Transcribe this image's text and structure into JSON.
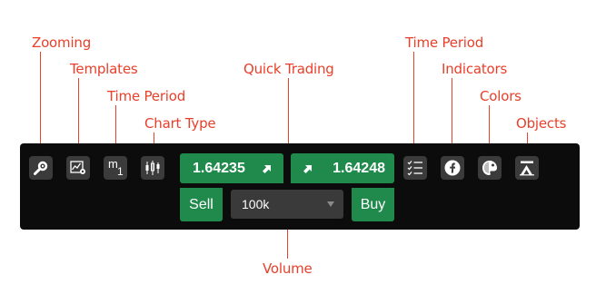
{
  "callouts": {
    "zooming": "Zooming",
    "templates": "Templates",
    "time_period_left": "Time Period",
    "chart_type": "Chart Type",
    "quick_trading": "Quick Trading",
    "time_period_right": "Time Period",
    "indicators": "Indicators",
    "colors": "Colors",
    "objects": "Objects",
    "volume": "Volume"
  },
  "toolbar": {
    "period_main": "m",
    "period_sub": "1",
    "sell_price": "1.64235",
    "buy_price": "1.64248",
    "sell_label": "Sell",
    "buy_label": "Buy",
    "volume_value": "100k"
  },
  "colors": {
    "callout": "#e8402a",
    "toolbar_bg": "#0c0c0c",
    "button_bg": "#3b3b3b",
    "trade_green": "#1f8a4c"
  },
  "icons": [
    "zoom-icon",
    "templates-icon",
    "candlestick-icon",
    "list-icon",
    "indicators-icon",
    "colors-icon",
    "objects-icon"
  ]
}
